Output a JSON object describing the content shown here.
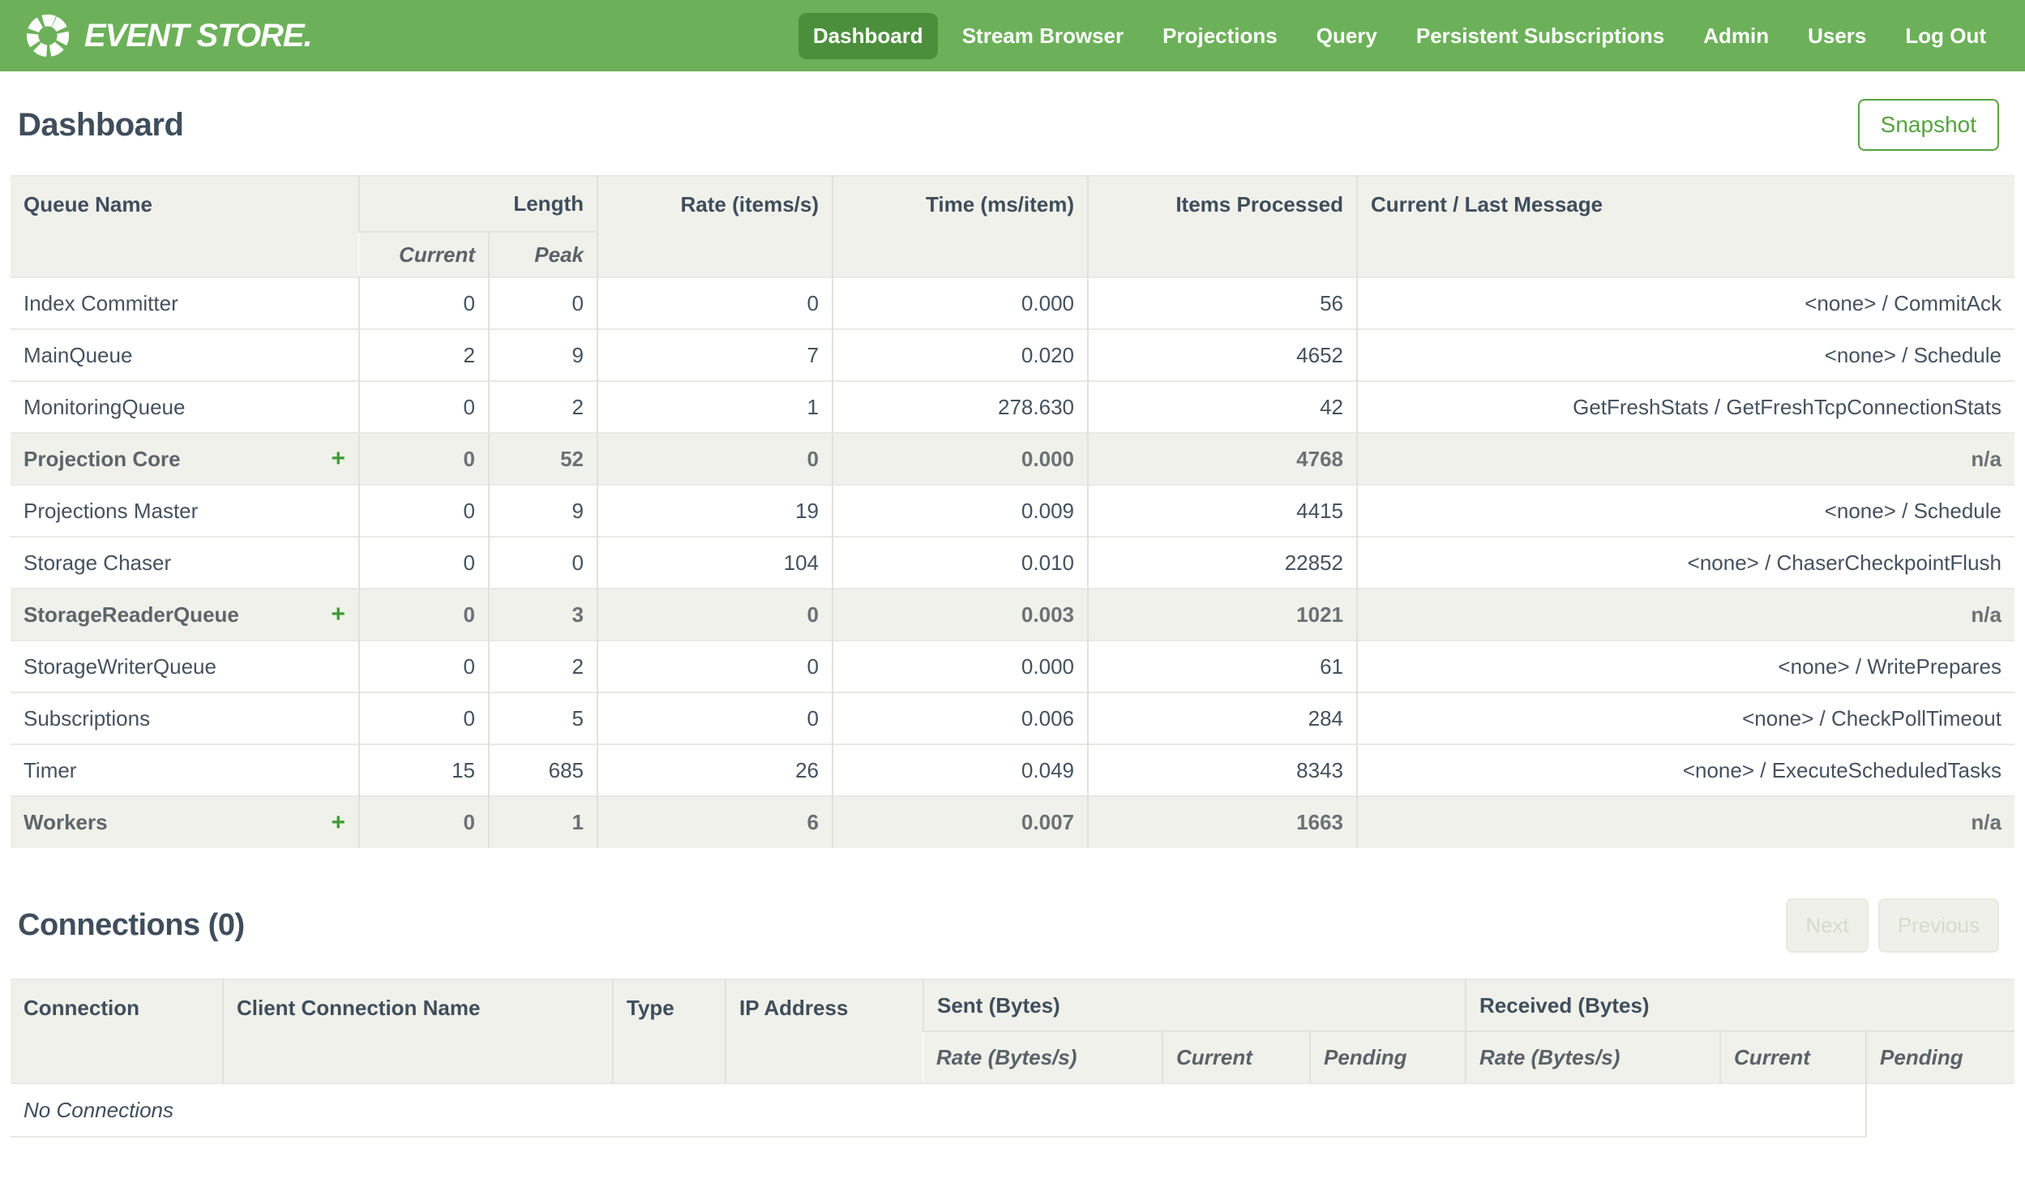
{
  "brand": {
    "name": "EVENT STORE.",
    "logo_icon": "segmented-ring-icon"
  },
  "nav": {
    "items": [
      {
        "label": "Dashboard",
        "active": true
      },
      {
        "label": "Stream Browser",
        "active": false
      },
      {
        "label": "Projections",
        "active": false
      },
      {
        "label": "Query",
        "active": false
      },
      {
        "label": "Persistent Subscriptions",
        "active": false
      },
      {
        "label": "Admin",
        "active": false
      },
      {
        "label": "Users",
        "active": false
      },
      {
        "label": "Log Out",
        "active": false
      }
    ]
  },
  "dashboard": {
    "title": "Dashboard",
    "snapshot_button": "Snapshot"
  },
  "queues": {
    "headers": {
      "queue_name": "Queue Name",
      "length": "Length",
      "current": "Current",
      "peak": "Peak",
      "rate": "Rate (items/s)",
      "time": "Time (ms/item)",
      "items_processed": "Items Processed",
      "message": "Current / Last Message"
    },
    "expand_symbol": "+",
    "rows": [
      {
        "name": "Index Committer",
        "group": false,
        "current": "0",
        "peak": "0",
        "rate": "0",
        "time": "0.000",
        "items": "56",
        "message": "<none> / CommitAck"
      },
      {
        "name": "MainQueue",
        "group": false,
        "current": "2",
        "peak": "9",
        "rate": "7",
        "time": "0.020",
        "items": "4652",
        "message": "<none> / Schedule"
      },
      {
        "name": "MonitoringQueue",
        "group": false,
        "current": "0",
        "peak": "2",
        "rate": "1",
        "time": "278.630",
        "items": "42",
        "message": "GetFreshStats / GetFreshTcpConnectionStats"
      },
      {
        "name": "Projection Core",
        "group": true,
        "current": "0",
        "peak": "52",
        "rate": "0",
        "time": "0.000",
        "items": "4768",
        "message": "n/a"
      },
      {
        "name": "Projections Master",
        "group": false,
        "current": "0",
        "peak": "9",
        "rate": "19",
        "time": "0.009",
        "items": "4415",
        "message": "<none> / Schedule"
      },
      {
        "name": "Storage Chaser",
        "group": false,
        "current": "0",
        "peak": "0",
        "rate": "104",
        "time": "0.010",
        "items": "22852",
        "message": "<none> / ChaserCheckpointFlush"
      },
      {
        "name": "StorageReaderQueue",
        "group": true,
        "current": "0",
        "peak": "3",
        "rate": "0",
        "time": "0.003",
        "items": "1021",
        "message": "n/a"
      },
      {
        "name": "StorageWriterQueue",
        "group": false,
        "current": "0",
        "peak": "2",
        "rate": "0",
        "time": "0.000",
        "items": "61",
        "message": "<none> / WritePrepares"
      },
      {
        "name": "Subscriptions",
        "group": false,
        "current": "0",
        "peak": "5",
        "rate": "0",
        "time": "0.006",
        "items": "284",
        "message": "<none> / CheckPollTimeout"
      },
      {
        "name": "Timer",
        "group": false,
        "current": "15",
        "peak": "685",
        "rate": "26",
        "time": "0.049",
        "items": "8343",
        "message": "<none> / ExecuteScheduledTasks"
      },
      {
        "name": "Workers",
        "group": true,
        "current": "0",
        "peak": "1",
        "rate": "6",
        "time": "0.007",
        "items": "1663",
        "message": "n/a"
      }
    ]
  },
  "connections": {
    "title": "Connections (0)",
    "next_button": "Next",
    "previous_button": "Previous",
    "headers": {
      "connection": "Connection",
      "client_name": "Client Connection Name",
      "type": "Type",
      "ip": "IP Address",
      "sent": "Sent (Bytes)",
      "received": "Received (Bytes)",
      "rate": "Rate (Bytes/s)",
      "current": "Current",
      "pending": "Pending"
    },
    "empty_message": "No Connections"
  },
  "colors": {
    "brand_green": "#6cb159",
    "active_nav_green": "#4b8f3c",
    "accent_green": "#55a33e",
    "plus_green": "#3f9a33",
    "header_bg": "#f0f1ea",
    "text_dark": "#3f4e5c"
  }
}
